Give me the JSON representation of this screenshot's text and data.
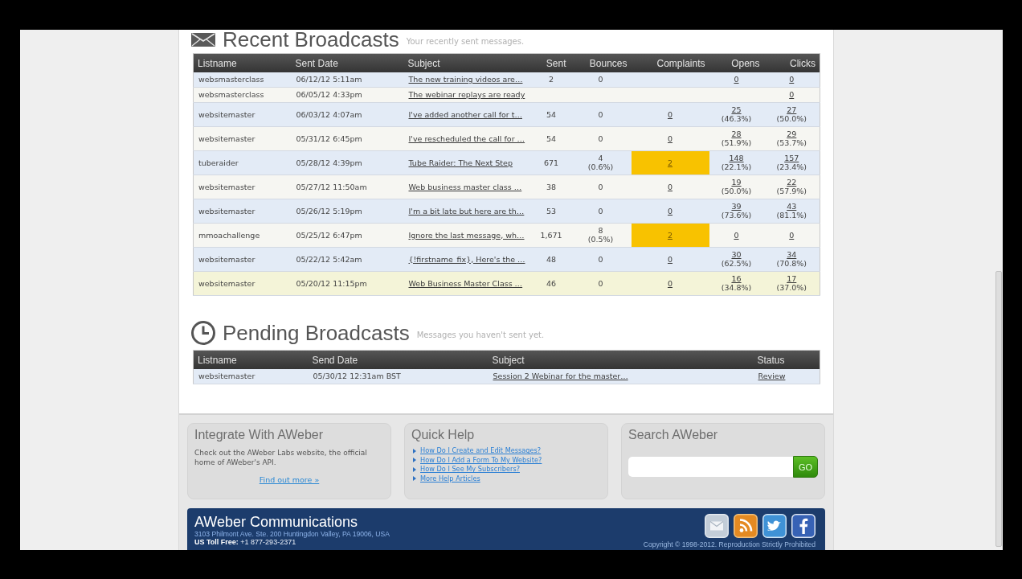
{
  "recent_broadcasts": {
    "title": "Recent Broadcasts",
    "subtitle": "Your recently sent messages.",
    "columns": [
      "Listname",
      "Sent Date",
      "Subject",
      "Sent",
      "Bounces",
      "Complaints",
      "Opens",
      "Clicks"
    ],
    "rows": [
      {
        "listname": "websmasterclass",
        "sent_date": "06/12/12 5:11am",
        "subject": "The new training videos are…",
        "sent": "2",
        "bounces": {
          "count": "0"
        },
        "complaints": {
          "flagged": false
        },
        "opens": {
          "count": "0"
        },
        "clicks": {
          "count": "0"
        },
        "hovered": false
      },
      {
        "listname": "websmasterclass",
        "sent_date": "06/05/12 4:33pm",
        "subject": "The webinar replays are ready",
        "complaints": {
          "flagged": false
        },
        "clicks": {
          "count": "0"
        },
        "hovered": false
      },
      {
        "listname": "websitemaster",
        "sent_date": "06/03/12 4:07am",
        "subject": "I've added another call for t…",
        "sent": "54",
        "bounces": {
          "count": "0"
        },
        "complaints": {
          "count": "0",
          "flagged": false
        },
        "opens": {
          "count": "25",
          "share": "(46.3%)"
        },
        "clicks": {
          "count": "27",
          "share": "(50.0%)"
        },
        "hovered": false
      },
      {
        "listname": "websitemaster",
        "sent_date": "05/31/12 6:45pm",
        "subject": "I've rescheduled the call for …",
        "sent": "54",
        "bounces": {
          "count": "0"
        },
        "complaints": {
          "count": "0",
          "flagged": false
        },
        "opens": {
          "count": "28",
          "share": "(51.9%)"
        },
        "clicks": {
          "count": "29",
          "share": "(53.7%)"
        },
        "hovered": false
      },
      {
        "listname": "tuberaider",
        "sent_date": "05/28/12 4:39pm",
        "subject": "Tube Raider: The Next Step",
        "sent": "671",
        "bounces": {
          "count": "4",
          "share": "(0.6%)"
        },
        "complaints": {
          "count": "2",
          "flagged": true
        },
        "opens": {
          "count": "148",
          "share": "(22.1%)"
        },
        "clicks": {
          "count": "157",
          "share": "(23.4%)"
        },
        "hovered": false
      },
      {
        "listname": "websitemaster",
        "sent_date": "05/27/12 11:50am",
        "subject": "Web business master class …",
        "sent": "38",
        "bounces": {
          "count": "0"
        },
        "complaints": {
          "count": "0",
          "flagged": false
        },
        "opens": {
          "count": "19",
          "share": "(50.0%)"
        },
        "clicks": {
          "count": "22",
          "share": "(57.9%)"
        },
        "hovered": false
      },
      {
        "listname": "websitemaster",
        "sent_date": "05/26/12 5:19pm",
        "subject": "I'm a bit late but here are th…",
        "sent": "53",
        "bounces": {
          "count": "0"
        },
        "complaints": {
          "count": "0",
          "flagged": false
        },
        "opens": {
          "count": "39",
          "share": "(73.6%)"
        },
        "clicks": {
          "count": "43",
          "share": "(81.1%)"
        },
        "hovered": false
      },
      {
        "listname": "mmoachallenge",
        "sent_date": "05/25/12 6:47pm",
        "subject": "Ignore the last message, wh…",
        "sent": "1,671",
        "bounces": {
          "count": "8",
          "share": "(0.5%)"
        },
        "complaints": {
          "count": "2",
          "flagged": true
        },
        "opens": {
          "count": "0"
        },
        "clicks": {
          "count": "0"
        },
        "hovered": false
      },
      {
        "listname": "websitemaster",
        "sent_date": "05/22/12 5:42am",
        "subject": "{!firstname_fix}, Here's the …",
        "sent": "48",
        "bounces": {
          "count": "0"
        },
        "complaints": {
          "count": "0",
          "flagged": false
        },
        "opens": {
          "count": "30",
          "share": "(62.5%)"
        },
        "clicks": {
          "count": "34",
          "share": "(70.8%)"
        },
        "hovered": false
      },
      {
        "listname": "websitemaster",
        "sent_date": "05/20/12 11:15pm",
        "subject": "Web Business Master Class …",
        "sent": "46",
        "bounces": {
          "count": "0"
        },
        "complaints": {
          "count": "0",
          "flagged": false
        },
        "opens": {
          "count": "16",
          "share": "(34.8%)"
        },
        "clicks": {
          "count": "17",
          "share": "(37.0%)"
        },
        "hovered": true
      }
    ]
  },
  "pending_broadcasts": {
    "title": "Pending Broadcasts",
    "subtitle": "Messages you haven't sent yet.",
    "columns": [
      "Listname",
      "Send Date",
      "Subject",
      "Status"
    ],
    "rows": [
      {
        "listname": "websitemaster",
        "send_date": "05/30/12 12:31am BST",
        "subject": "Session 2 Webinar for the master…",
        "status": "Review"
      }
    ]
  },
  "integrate_panel": {
    "title": "Integrate With AWeber",
    "text": "Check out the AWeber Labs website, the official home of AWeber's API.",
    "link": "Find out more »"
  },
  "quick_help_panel": {
    "title": "Quick Help",
    "links": [
      "How Do I Create and Edit Messages?",
      "How Do I Add a Form To My Website?",
      "How Do I See My Subscribers?",
      "More Help Articles"
    ]
  },
  "search_panel": {
    "title": "Search AWeber",
    "button": "GO"
  },
  "footer": {
    "company": "AWeber Communications",
    "address": "3103 Philmont Ave. Ste. 200 Huntingdon Valley, PA 19006, USA",
    "phone": "**US Toll Free:** +1 877-293-2371",
    "copyright": "Copyright © 1998-2012. Reproduction Strictly Prohibited"
  }
}
